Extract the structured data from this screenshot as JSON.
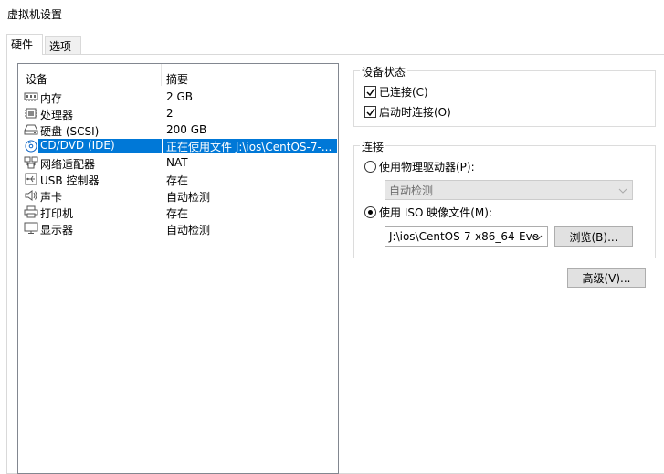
{
  "window": {
    "title": "虚拟机设置"
  },
  "tabs": [
    {
      "label": "硬件"
    },
    {
      "label": "选项"
    }
  ],
  "device_list": {
    "headers": {
      "device": "设备",
      "summary": "摘要"
    },
    "rows": [
      {
        "icon": "memory-icon",
        "name": "内存",
        "summary": "2 GB"
      },
      {
        "icon": "processor-icon",
        "name": "处理器",
        "summary": "2"
      },
      {
        "icon": "harddisk-icon",
        "name": "硬盘 (SCSI)",
        "summary": "200 GB"
      },
      {
        "icon": "cd-dvd-icon",
        "name": "CD/DVD (IDE)",
        "summary": "正在使用文件 J:\\ios\\CentOS-7-..."
      },
      {
        "icon": "network-adapter-icon",
        "name": "网络适配器",
        "summary": "NAT"
      },
      {
        "icon": "usb-controller-icon",
        "name": "USB 控制器",
        "summary": "存在"
      },
      {
        "icon": "sound-card-icon",
        "name": "声卡",
        "summary": "自动检测"
      },
      {
        "icon": "printer-icon",
        "name": "打印机",
        "summary": "存在"
      },
      {
        "icon": "display-icon",
        "name": "显示器",
        "summary": "自动检测"
      }
    ],
    "selected_index": 3
  },
  "device_status": {
    "title": "设备状态",
    "connected": {
      "label": "已连接(C)",
      "mnemonic": "C",
      "checked": true
    },
    "connect_at_power_on": {
      "label": "启动时连接(O)",
      "mnemonic": "O",
      "checked": true
    }
  },
  "connection": {
    "title": "连接",
    "physical_drive": {
      "label": "使用物理驱动器(P):",
      "mnemonic": "P",
      "selected": false
    },
    "physical_drive_value": "自动检测",
    "iso": {
      "label": "使用 ISO 映像文件(M):",
      "mnemonic": "M",
      "selected": true
    },
    "iso_path": "J:\\ios\\CentOS-7-x86_64-Eve",
    "browse_label": "浏览(B)..."
  },
  "advanced_label": "高级(V)...",
  "colors": {
    "selection": "#0078d7",
    "button_bg": "#e1e1e1",
    "border": "#adadad"
  }
}
